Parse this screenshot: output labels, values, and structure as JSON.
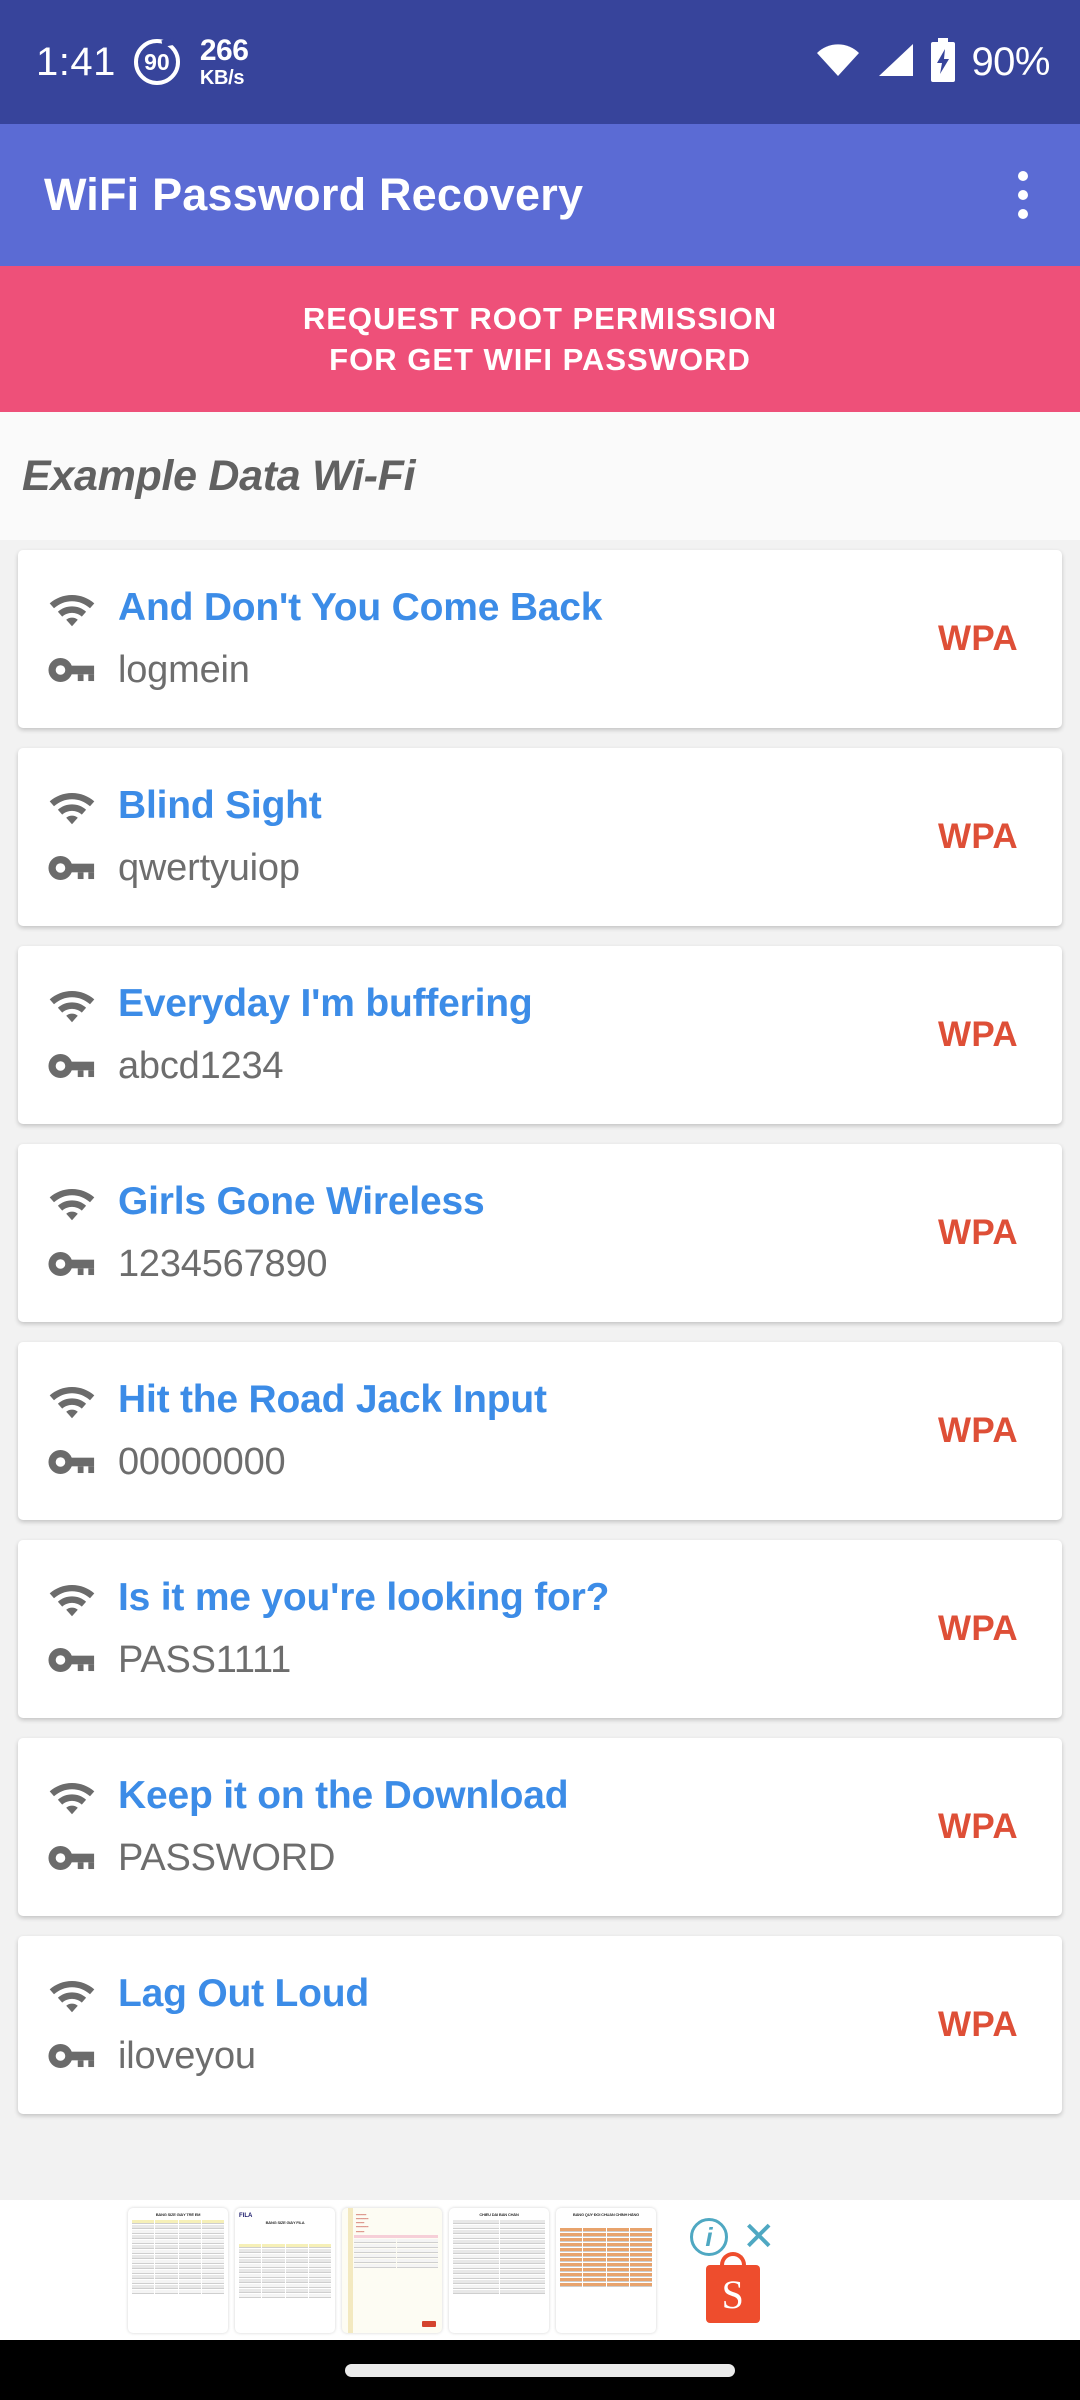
{
  "status_bar": {
    "clock": "1:41",
    "refresh_rate": "90",
    "net_speed": "266",
    "net_unit": "KB/s",
    "battery_pct": "90%",
    "icons": [
      "wifi-icon",
      "cellular-signal-icon",
      "battery-charging-icon"
    ]
  },
  "app_bar": {
    "title": "WiFi Password Recovery",
    "overflow_menu": "more-options"
  },
  "root_banner": {
    "line1": "REQUEST ROOT PERMISSION",
    "line2": "FOR GET WIFI PASSWORD",
    "color": "#EE5079"
  },
  "section": {
    "title": "Example Data Wi-Fi"
  },
  "colors": {
    "status_bar": "#37449B",
    "app_bar": "#5B6BD4",
    "banner": "#EE5079",
    "ssid": "#3C8CE7",
    "password": "#6D6D6D",
    "security": "#DE4F37",
    "page_bg": "#F2F2F2"
  },
  "networks": [
    {
      "ssid": "And Don't You Come Back",
      "password": "logmein",
      "security": "WPA"
    },
    {
      "ssid": "Blind Sight",
      "password": "qwertyuiop",
      "security": "WPA"
    },
    {
      "ssid": "Everyday I'm buffering",
      "password": "abcd1234",
      "security": "WPA"
    },
    {
      "ssid": "Girls Gone Wireless",
      "password": "1234567890",
      "security": "WPA"
    },
    {
      "ssid": "Hit the Road Jack Input",
      "password": "00000000",
      "security": "WPA"
    },
    {
      "ssid": "Is it me you're looking for?",
      "password": "PASS1111",
      "security": "WPA"
    },
    {
      "ssid": "Keep it on the Download",
      "password": "PASSWORD",
      "security": "WPA"
    },
    {
      "ssid": "Lag Out Loud",
      "password": "iloveyou",
      "security": "WPA"
    }
  ],
  "ad": {
    "thumbnails": [
      {
        "title": "BẢNG SIZE GIÀY TRẺ EM",
        "kind": "table"
      },
      {
        "title": "BẢNG SIZE GIÀY FILA",
        "kind": "table-brand",
        "brand": "FILA"
      },
      {
        "title": "",
        "kind": "receipt"
      },
      {
        "title": "CHIỀU DÀI BÀN CHÂN",
        "kind": "table-plain"
      },
      {
        "title": "BẢNG QUY ĐỔI CHUẨN CHÍNH HÃNG",
        "kind": "table-orange"
      }
    ],
    "info_label": "i",
    "close_label": "✕",
    "advertiser": "S"
  },
  "nav_bar": {
    "gesture_handle": "home-gesture-pill"
  }
}
